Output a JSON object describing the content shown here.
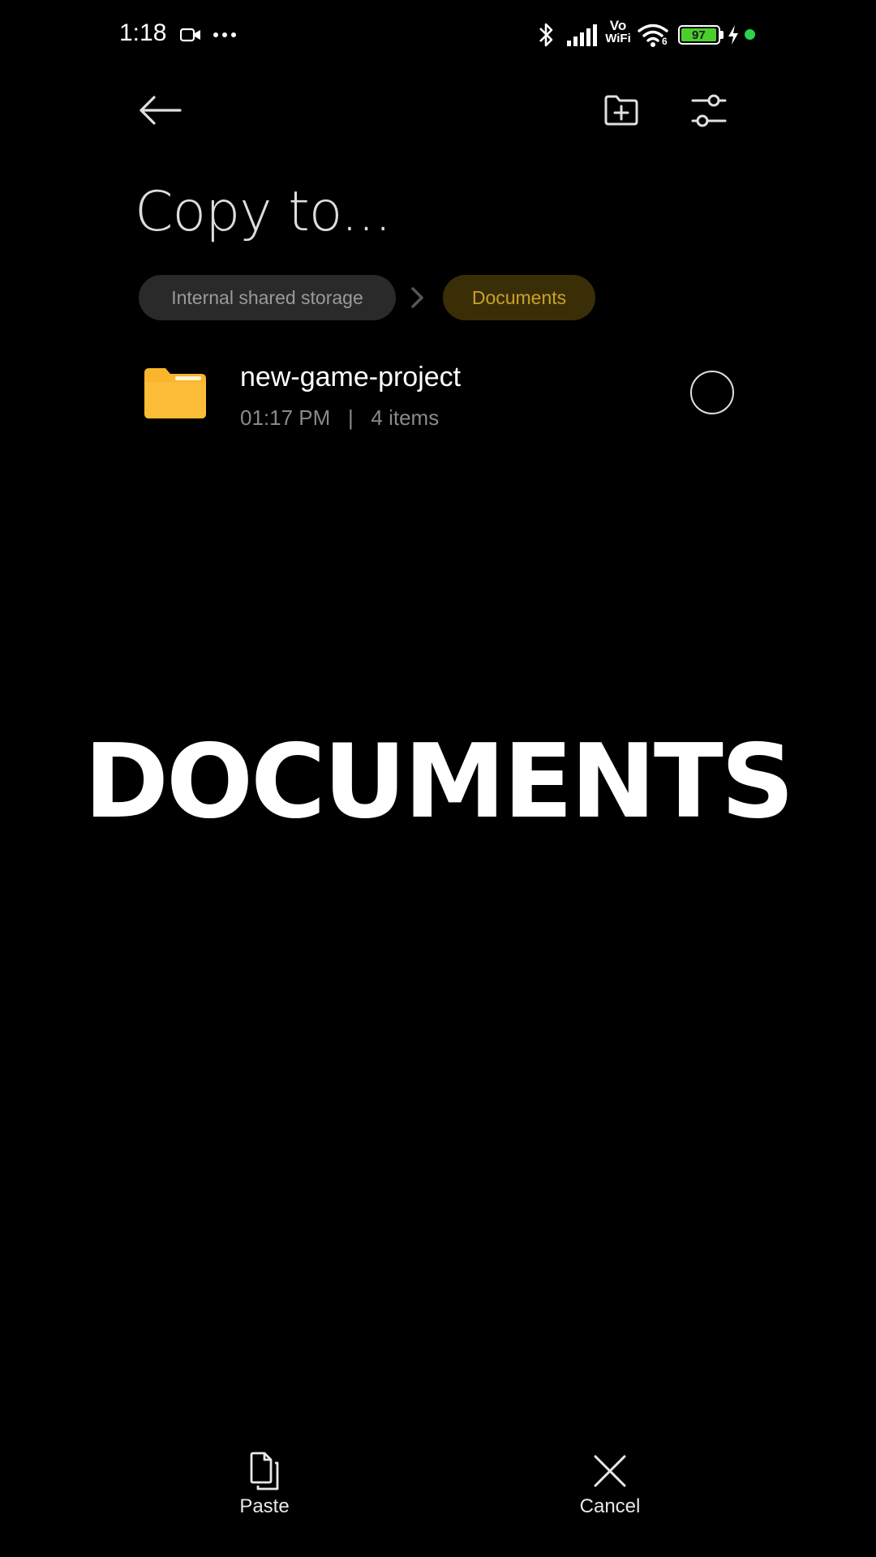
{
  "status_bar": {
    "time": "1:18",
    "battery_level": "97",
    "icons": [
      "video-call-icon",
      "more-dots-icon",
      "bluetooth-icon",
      "signal-icon",
      "vowifi-icon",
      "wifi-icon",
      "battery-icon",
      "charging-icon",
      "privacy-dot-icon"
    ],
    "vowifi_top": "Vo",
    "vowifi_bottom": "WiFi",
    "wifi_badge": "6"
  },
  "header": {
    "title": "Copy to...",
    "actions": [
      "back-arrow-icon",
      "new-folder-icon",
      "sort-settings-icon"
    ]
  },
  "breadcrumb": {
    "items": [
      {
        "label": "Internal shared storage"
      },
      {
        "label": "Documents"
      }
    ],
    "active_color": "#c8a22c"
  },
  "folders": [
    {
      "name": "new-game-project",
      "time": "01:17 PM",
      "separator": "|",
      "items": "4 items",
      "icon": "folder-icon",
      "icon_color": "#f9b52c"
    }
  ],
  "overlay_caption": "DOCUMENTS",
  "bottom_actions": {
    "paste_label": "Paste",
    "cancel_label": "Cancel"
  }
}
